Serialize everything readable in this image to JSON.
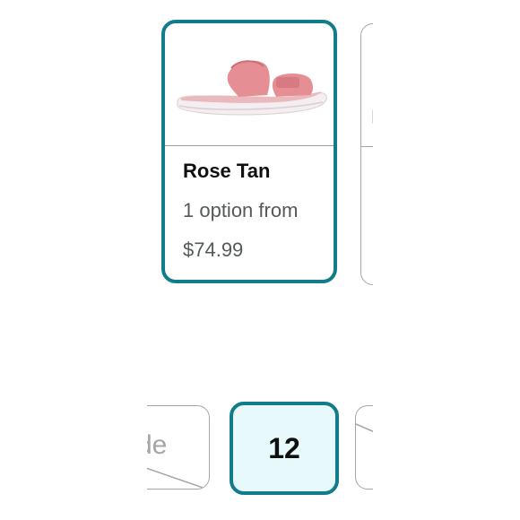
{
  "color_swatches": {
    "selected": {
      "name": "Rose Tan",
      "option_text": "1 option from",
      "price": "$74.99",
      "image_icon": "pink-slide-sandal-image"
    }
  },
  "size_buttons": {
    "previous_label": "de",
    "selected_label": "12"
  },
  "colors": {
    "selected_border": "#117d8b",
    "selected_size_bg": "#e8f9fb",
    "unselected_border": "#a6a6a6",
    "sandal_upper": "#e58f94",
    "sandal_sole": "#f4eef0"
  }
}
